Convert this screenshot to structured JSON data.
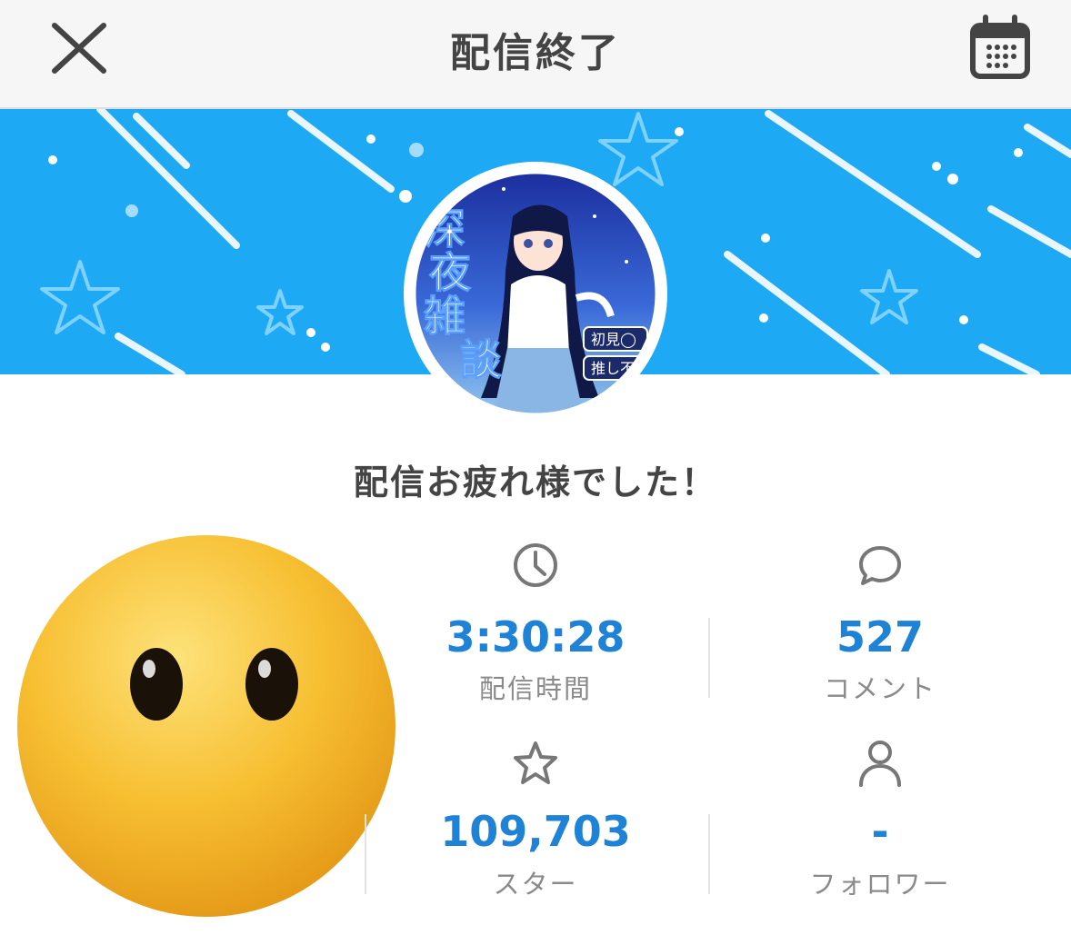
{
  "header": {
    "title": "配信終了"
  },
  "message": "配信お疲れ様でした！",
  "stats": [
    {
      "icon": "clock-icon",
      "value": "3:30:28",
      "label": "配信時間"
    },
    {
      "icon": "comment-icon",
      "value": "527",
      "label": "コメント"
    },
    {
      "icon": "star-icon",
      "value": "109,703",
      "label": "スター"
    },
    {
      "icon": "person-icon",
      "value": "-",
      "label": "フォロワー"
    }
  ],
  "avatar": {
    "text": [
      "深",
      "夜",
      "雑",
      "談"
    ],
    "badges": [
      "初見◯",
      "推し不在"
    ]
  },
  "colors": {
    "accent": "#1e82d6",
    "banner": "#1ea9f4",
    "emoji": "#f6b62c"
  }
}
